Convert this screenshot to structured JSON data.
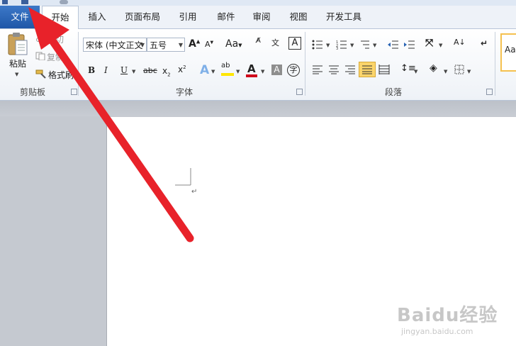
{
  "tabs": [
    {
      "label": "文件"
    },
    {
      "label": "开始"
    },
    {
      "label": "插入"
    },
    {
      "label": "页面布局"
    },
    {
      "label": "引用"
    },
    {
      "label": "邮件"
    },
    {
      "label": "审阅"
    },
    {
      "label": "视图"
    },
    {
      "label": "开发工具"
    }
  ],
  "clipboard": {
    "paste_label": "粘贴",
    "cut_label": "剪切",
    "copy_label": "复制",
    "format_painter_label": "格式刷",
    "group_label": "剪贴板"
  },
  "font": {
    "font_name": "宋体 (中文正文",
    "font_size": "五号",
    "group_label": "字体"
  },
  "paragraph": {
    "group_label": "段落"
  },
  "styles": {
    "partial_label": "Aa"
  },
  "watermark": {
    "brand": "Baidu经验",
    "url": "jingyan.baidu.com"
  },
  "colors": {
    "file_tab": "#2a64b4",
    "annotation_arrow": "#e8222a",
    "highlight_yellow": "#ffe600",
    "font_red": "#d0021b"
  }
}
